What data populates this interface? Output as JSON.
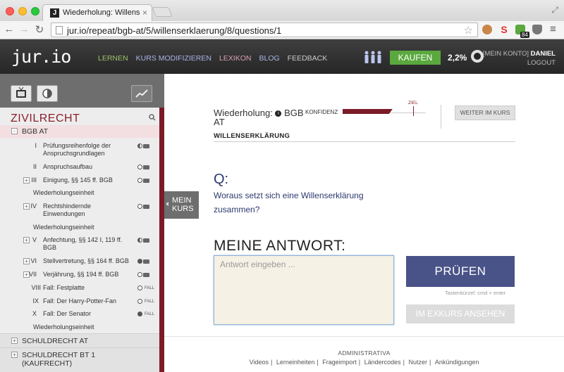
{
  "browser": {
    "tab_title": "Wiederholung: Willenserklä",
    "favicon_letter": "J",
    "tab_close": "×",
    "url": "jur.io/repeat/bgb-at/5/willenserklaerung/8/questions/1",
    "extension_badge": "84"
  },
  "header": {
    "logo": "jur.io",
    "nav": [
      {
        "label": "LERNEN",
        "color": "#9bc16a"
      },
      {
        "label": "KURS MODIFIZIEREN",
        "color": "#a9b4e6"
      },
      {
        "label": "LEXIKON",
        "color": "#d9a2b0"
      },
      {
        "label": "BLOG",
        "color": "#a9b4e6"
      },
      {
        "label": "FEEDBACK",
        "color": "#cccccc"
      }
    ],
    "buy_label": "KAUFEN",
    "percent": "2,2%",
    "konto_prefix": "[MEIN KONTO]",
    "user_name": "DANIEL",
    "logout": "LOGOUT"
  },
  "sidebar": {
    "title": "ZIVILRECHT",
    "course": "BGB AT",
    "items": [
      {
        "num": "I",
        "label": "Prüfungsreihenfolge der Anspruchsgrundlagen",
        "status": "half"
      },
      {
        "num": "II",
        "label": "Anspruchsaufbau",
        "status": "empty"
      },
      {
        "num": "III",
        "label": "Einigung, §§ 145 ff. BGB",
        "status": "empty"
      },
      {
        "label": "Wiederholungseinheit"
      },
      {
        "num": "IV",
        "label": "Rechtshindernde Einwendungen",
        "status": "empty"
      },
      {
        "label": "Wiederholungseinheit"
      },
      {
        "num": "V",
        "label": "Anfechtung, §§ 142 I, 119 ff. BGB",
        "status": "half"
      },
      {
        "num": "VI",
        "label": "Stellvertretung, §§ 164 ff. BGB",
        "status": "full"
      },
      {
        "num": "VII",
        "label": "Verjährung, §§ 194 ff. BGB",
        "status": "empty"
      },
      {
        "num": "VIII",
        "label": "Fall: Festplatte",
        "status": "empty",
        "tag": "FALL"
      },
      {
        "num": "IX",
        "label": "Fall: Der Harry-Potter-Fan",
        "status": "empty",
        "tag": "FALL"
      },
      {
        "num": "X",
        "label": "Fall: Der Senator",
        "status": "full",
        "tag": "FALL"
      },
      {
        "label": "Wiederholungseinheit"
      }
    ],
    "sections": [
      "SCHULDRECHT AT",
      "SCHULDRECHT BT 1 (KAUFRECHT)"
    ],
    "mein_kurs": "MEIN KURS"
  },
  "main": {
    "heading_line1": "Wiederholung:",
    "heading_bgb": "BGB",
    "heading_line2": "AT",
    "confidence_label": "KONFIDENZ",
    "confidence_value": 0.6,
    "goal_label": "ZIEL",
    "continue_label": "WEITER IM KURS",
    "topic": "WILLENSERKLÄRUNG",
    "q_label": "Q:",
    "question": "Woraus setzt sich eine Willenserklärung zusammen?",
    "answer_title": "MEINE ANTWORT:",
    "answer_placeholder": "Antwort eingeben ...",
    "check_label": "PRÜFEN",
    "shortcut": "Tastenkürzel: cmd + enter",
    "excursus_label": "IM EXKURS ANSEHEN",
    "footer_title": "ADMINISTRATIVA",
    "footer_links": [
      "Videos",
      "Lerneinheiten",
      "Frageimport",
      "Ländercodes",
      "Nutzer",
      "Ankündigungen"
    ]
  }
}
